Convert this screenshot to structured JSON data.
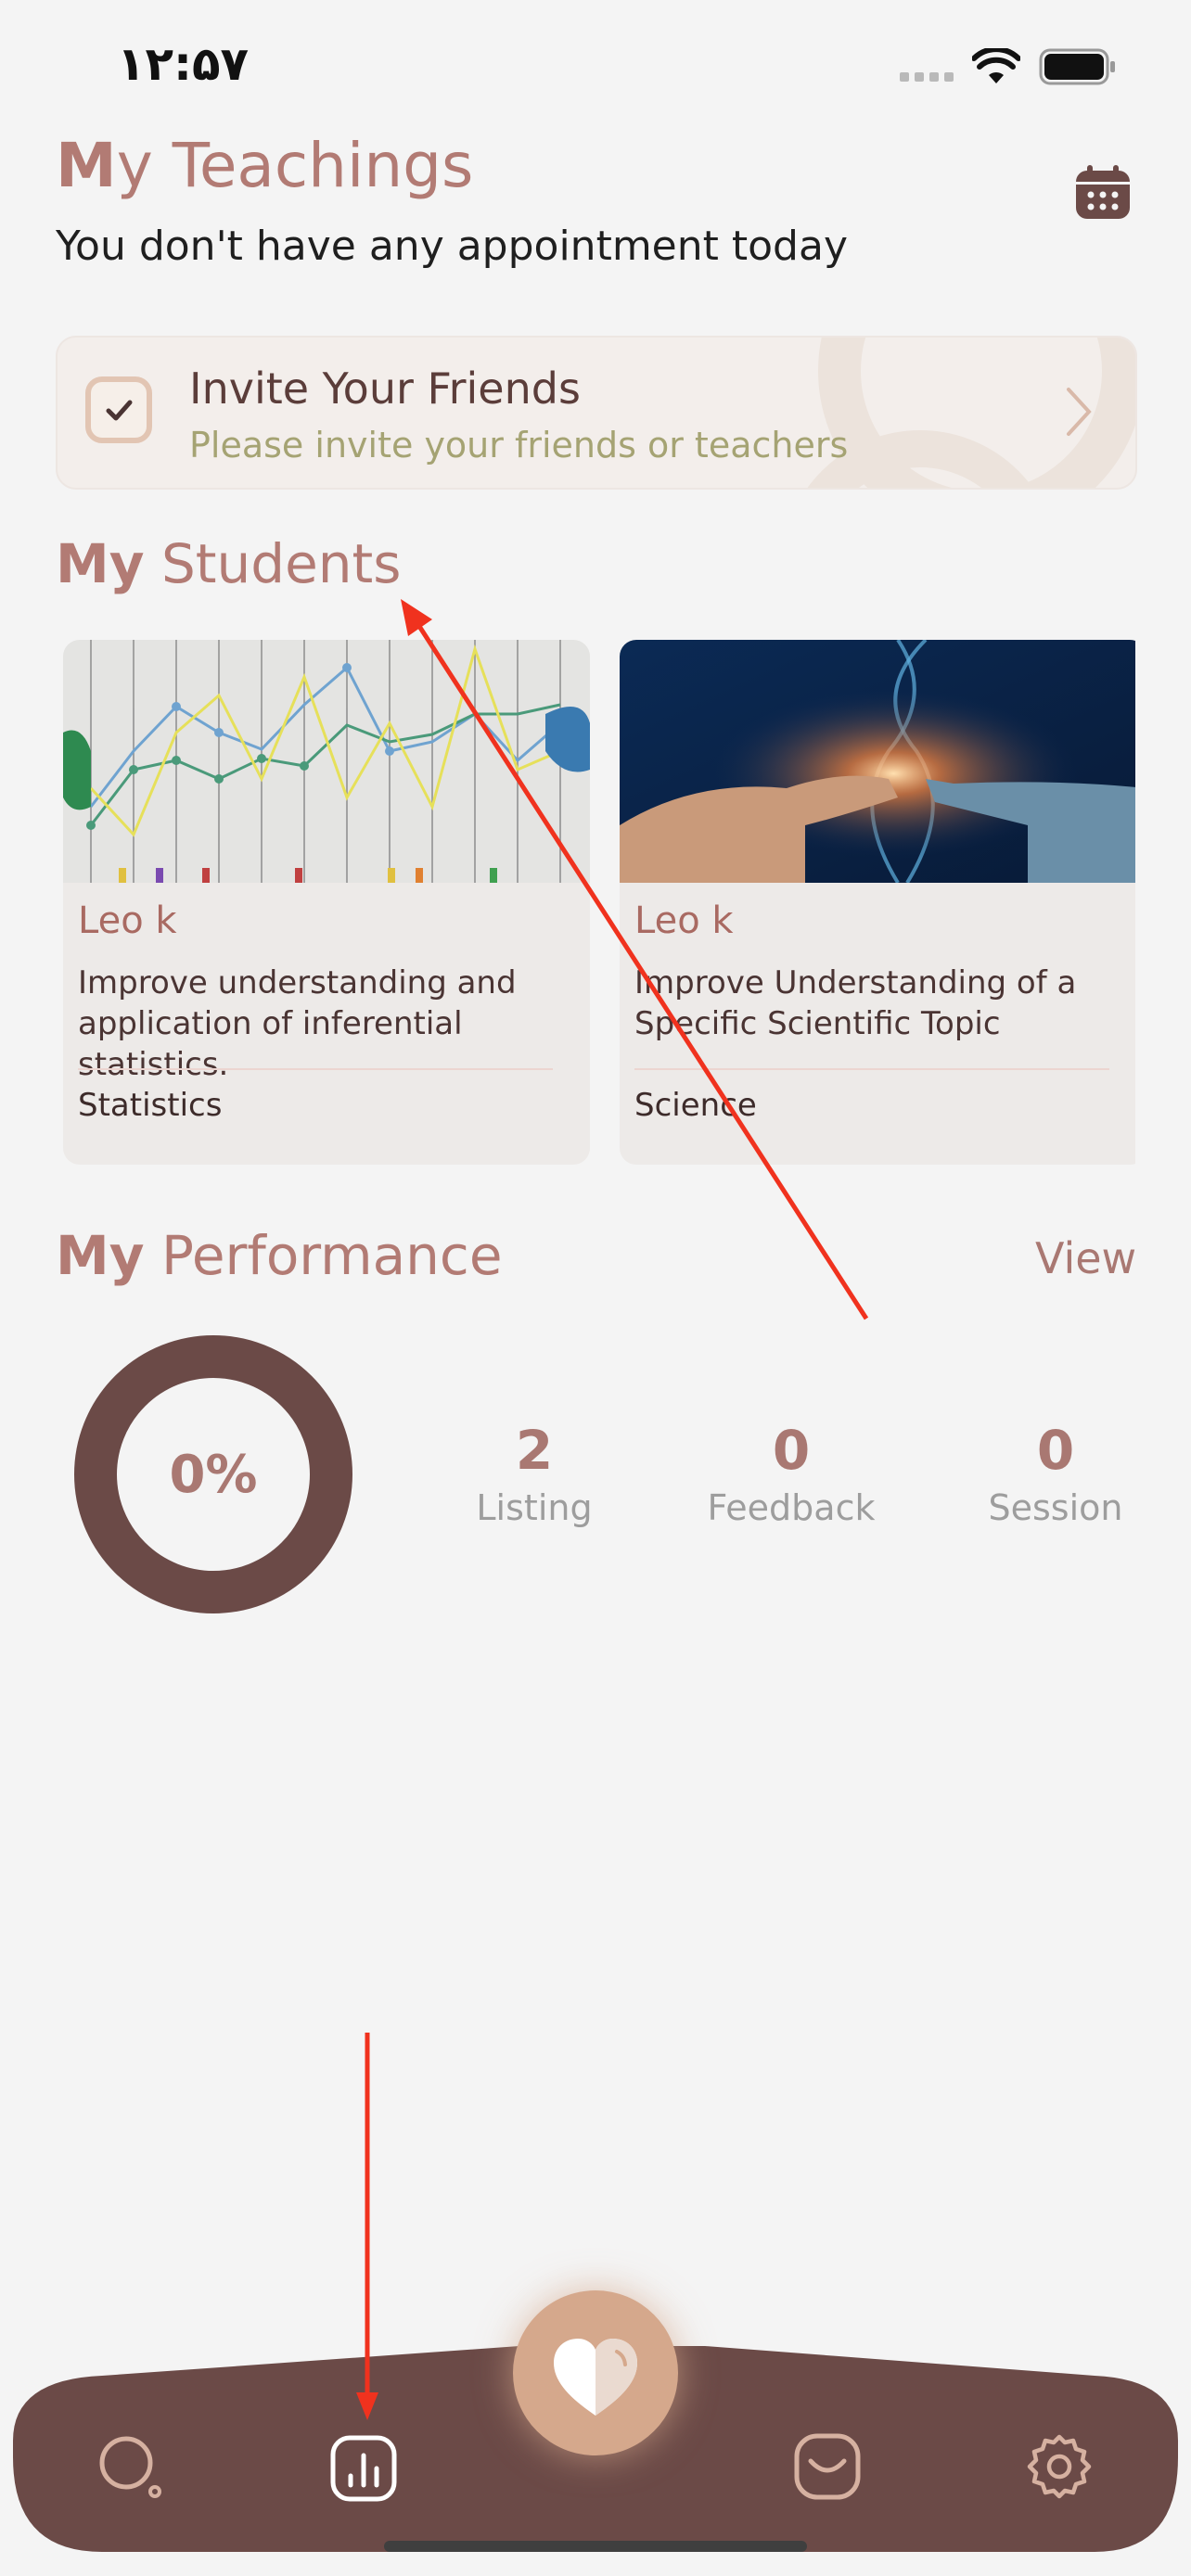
{
  "status_bar": {
    "time": "۱۲:۵۷"
  },
  "header": {
    "title_first_letter": "M",
    "title_rest": "y Teachings",
    "subtitle": "You don't have any appointment today"
  },
  "invite": {
    "title": "Invite Your Friends",
    "subtitle": "Please invite your friends or teachers"
  },
  "students": {
    "title_bold": "My",
    "title_rest": " Students",
    "cards": [
      {
        "name": "Leo k",
        "description": "Improve understanding and application of inferential statistics.",
        "subject": "Statistics",
        "image": "statistics-chart-photo"
      },
      {
        "name": "Leo k",
        "description": "Improve Understanding of a Specific Scientific Topic",
        "subject": "Science",
        "image": "science-dna-hand-photo"
      }
    ]
  },
  "performance": {
    "title_bold": "My",
    "title_rest": " Performance",
    "view_label": "View",
    "percent_label": "0%",
    "percent_value": 0,
    "stats": [
      {
        "value": "2",
        "label": "Listing"
      },
      {
        "value": "0",
        "label": "Feedback"
      },
      {
        "value": "0",
        "label": "Session"
      }
    ]
  },
  "nav": {
    "items": [
      "search-icon",
      "stats-icon",
      "heart-icon",
      "inbox-icon",
      "gear-icon"
    ]
  },
  "colors": {
    "accent": "#b27b74",
    "nav_bg": "#6b4a47",
    "fab": "#d5a88c",
    "annotation": "#f0321e"
  }
}
